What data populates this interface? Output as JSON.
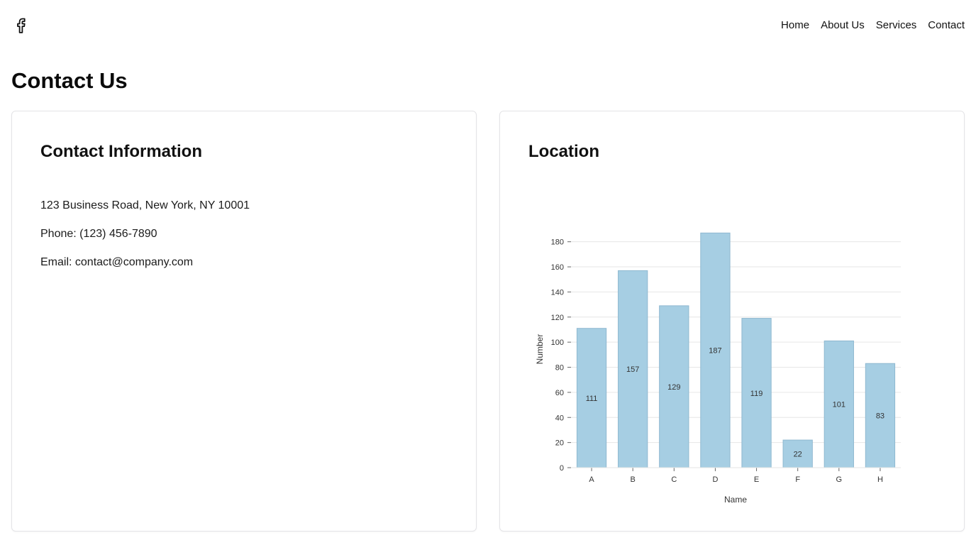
{
  "header": {
    "logo_icon": "facebook-icon",
    "nav": [
      "Home",
      "About Us",
      "Services",
      "Contact"
    ]
  },
  "page": {
    "title": "Contact Us"
  },
  "contact_card": {
    "title": "Contact Information",
    "address": "123 Business Road, New York, NY 10001",
    "phone": "Phone: (123) 456-7890",
    "email": "Email: contact@company.com"
  },
  "location_card": {
    "title": "Location"
  },
  "chart_data": {
    "type": "bar",
    "categories": [
      "A",
      "B",
      "C",
      "D",
      "E",
      "F",
      "G",
      "H"
    ],
    "values": [
      111,
      157,
      129,
      187,
      119,
      22,
      101,
      83
    ],
    "xlabel": "Name",
    "ylabel": "Number",
    "yticks": [
      0,
      20,
      40,
      60,
      80,
      100,
      120,
      140,
      160,
      180
    ],
    "ylim": [
      0,
      190
    ],
    "grid": true,
    "bar_color": "#a6cee3",
    "bar_stroke": "#8fb8d0",
    "show_value_labels": true
  }
}
